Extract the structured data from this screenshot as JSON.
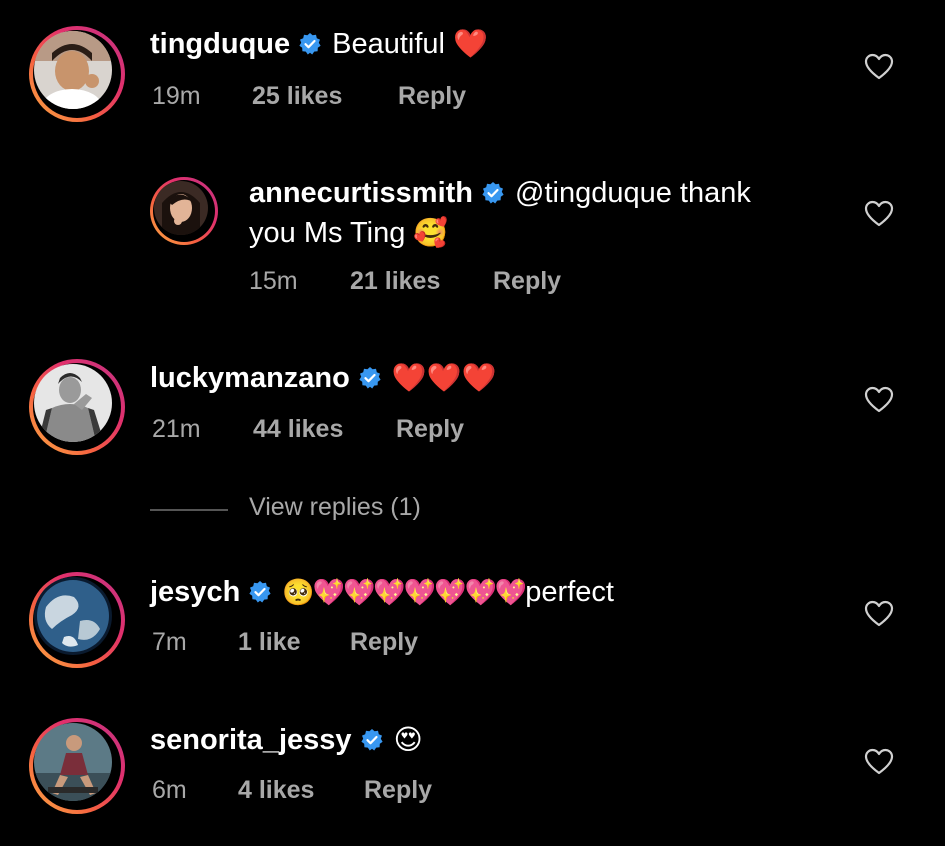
{
  "comments": [
    {
      "username": "tingduque",
      "text": "Beautiful",
      "emoji": "❤️",
      "time": "19m",
      "likes": "25 likes",
      "reply": "Reply"
    },
    {
      "username": "annecurtissmith",
      "text": "@tingduque thank",
      "text2": "you Ms Ting",
      "emoji": "🥰",
      "time": "15m",
      "likes": "21 likes",
      "reply": "Reply"
    },
    {
      "username": "luckymanzano",
      "emoji": "❤️❤️❤️",
      "time": "21m",
      "likes": "44 likes",
      "reply": "Reply",
      "view_replies": "View replies (1)"
    },
    {
      "username": "jesych",
      "emoji": "🥺💖💖💖💖💖💖💖",
      "text": "perfect",
      "time": "7m",
      "likes": "1 like",
      "reply": "Reply"
    },
    {
      "username": "senorita_jessy",
      "emoji": "😍",
      "time": "6m",
      "likes": "4 likes",
      "reply": "Reply"
    }
  ],
  "icons": {
    "verified": "verified-badge-icon",
    "like": "heart-outline-icon"
  },
  "colors": {
    "verified_blue": "#3897f0",
    "meta_gray": "#a8a8a8",
    "ring_gradient": [
      "#c13584",
      "#e1306c",
      "#f56040",
      "#fcaf45"
    ]
  }
}
